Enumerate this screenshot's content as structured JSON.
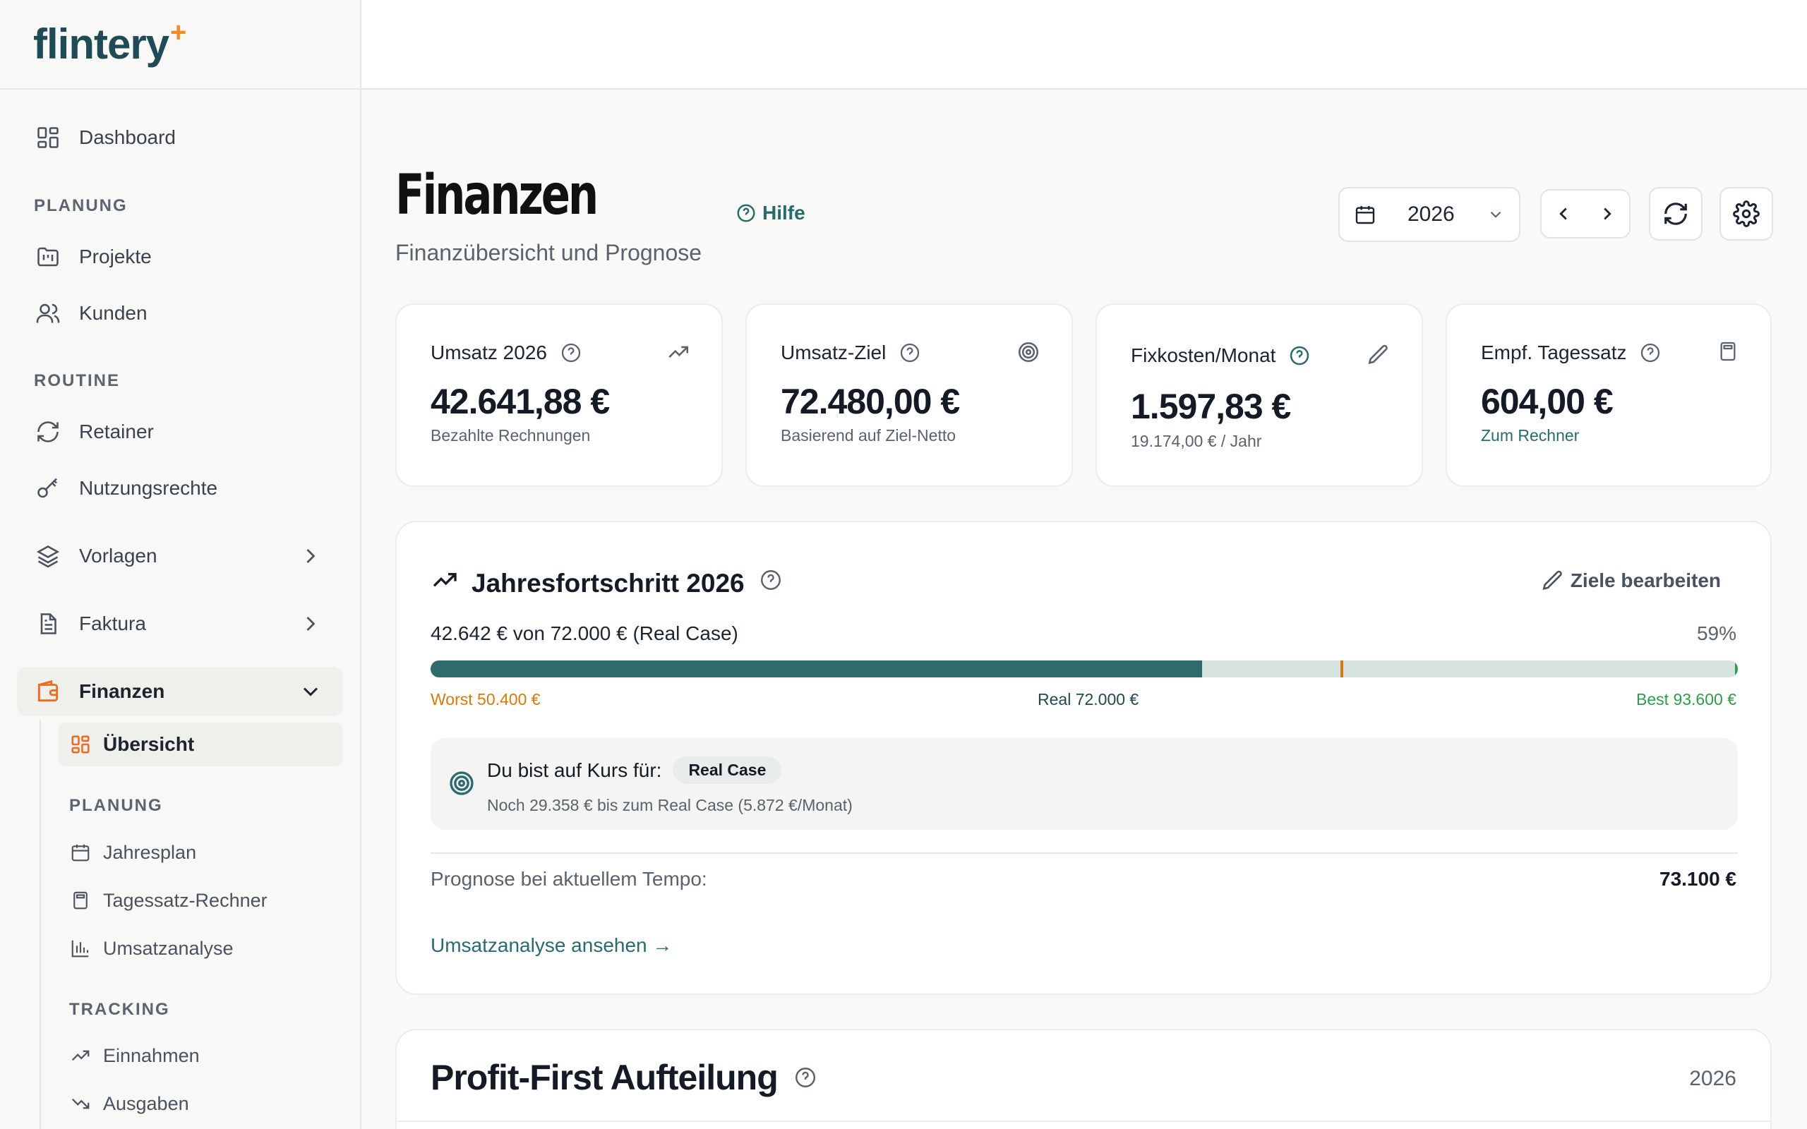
{
  "app": {
    "logo": "flintery",
    "logo_spark": "+"
  },
  "sidebar": {
    "dashboard": "Dashboard",
    "section_planung": "PLANUNG",
    "projekte": "Projekte",
    "kunden": "Kunden",
    "section_routine": "ROUTINE",
    "retainer": "Retainer",
    "nutzungsrechte": "Nutzungsrechte",
    "vorlagen": "Vorlagen",
    "faktura": "Faktura",
    "finanzen": "Finanzen",
    "sub": {
      "uebersicht": "Übersicht",
      "section_planung": "PLANUNG",
      "jahresplan": "Jahresplan",
      "tagessatz": "Tagessatz-Rechner",
      "umsatzanalyse": "Umsatzanalyse",
      "section_tracking": "TRACKING",
      "einnahmen": "Einnahmen",
      "ausgaben": "Ausgaben"
    }
  },
  "header": {
    "title": "Finanzen",
    "subtitle": "Finanzübersicht und Prognose",
    "help": "Hilfe",
    "year": "2026"
  },
  "kpis": [
    {
      "label": "Umsatz 2026",
      "value": "42.641,88 €",
      "sub": "Bezahlte Rechnungen"
    },
    {
      "label": "Umsatz-Ziel",
      "value": "72.480,00 €",
      "sub": "Basierend auf Ziel-Netto"
    },
    {
      "label": "Fixkosten/Monat",
      "value": "1.597,83 €",
      "sub": "19.174,00 € / Jahr"
    },
    {
      "label": "Empf. Tagessatz",
      "value": "604,00 €",
      "sub": "Zum Rechner"
    }
  ],
  "progress": {
    "title": "Jahresfortschritt 2026",
    "edit": "Ziele bearbeiten",
    "summary": "42.642 € von 72.000 € (Real Case)",
    "percent_label": "59%",
    "fill_fraction": 0.59,
    "worst_fraction": 0.696,
    "worst": "Worst 50.400 €",
    "real": "Real 72.000 €",
    "best": "Best 93.600 €",
    "track_head": "Du bist auf Kurs für:",
    "track_badge": "Real Case",
    "track_sub": "Noch 29.358 € bis zum Real Case (5.872 €/Monat)",
    "forecast_label": "Prognose bei aktuellem Tempo:",
    "forecast_value": "73.100 €",
    "analysis_link": "Umsatzanalyse ansehen →",
    "colors": {
      "fill": "#2f6b6d",
      "track": "#d5e2df",
      "worst": "#d9790d",
      "best": "#2f9c4a"
    }
  },
  "profit_first": {
    "title": "Profit-First Aufteilung",
    "year": "2026"
  }
}
